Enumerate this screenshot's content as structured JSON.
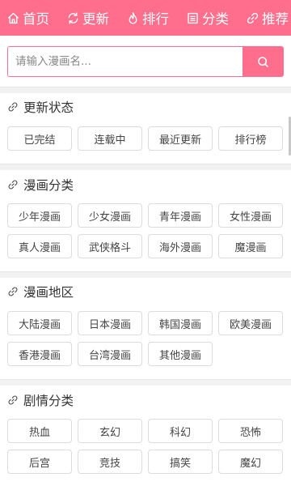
{
  "nav": [
    {
      "label": "首页",
      "icon": "home-icon"
    },
    {
      "label": "更新",
      "icon": "refresh-icon"
    },
    {
      "label": "排行",
      "icon": "fire-icon"
    },
    {
      "label": "分类",
      "icon": "list-icon"
    },
    {
      "label": "推荐",
      "icon": "link-icon"
    }
  ],
  "search": {
    "placeholder": "请输入漫画名...",
    "value": "",
    "icon": "search-icon"
  },
  "sections": [
    {
      "title": "更新状态",
      "icon": "link-icon",
      "tags": [
        "已完结",
        "连载中",
        "最近更新",
        "排行榜"
      ]
    },
    {
      "title": "漫画分类",
      "icon": "link-icon",
      "tags": [
        "少年漫画",
        "少女漫画",
        "青年漫画",
        "女性漫画",
        "真人漫画",
        "武侠格斗",
        "海外漫画",
        "魔漫画"
      ]
    },
    {
      "title": "漫画地区",
      "icon": "link-icon",
      "tags": [
        "大陆漫画",
        "日本漫画",
        "韩国漫画",
        "欧美漫画",
        "香港漫画",
        "台湾漫画",
        "其他漫画"
      ]
    },
    {
      "title": "剧情分类",
      "icon": "link-icon",
      "tags": [
        "热血",
        "玄幻",
        "科幻",
        "恐怖",
        "后宫",
        "竞技",
        "搞笑",
        "魔幻"
      ]
    }
  ],
  "colors": {
    "accent": "#ff6f8d",
    "divider": "#f2f2f2",
    "tag_border": "#dcdcdc"
  }
}
